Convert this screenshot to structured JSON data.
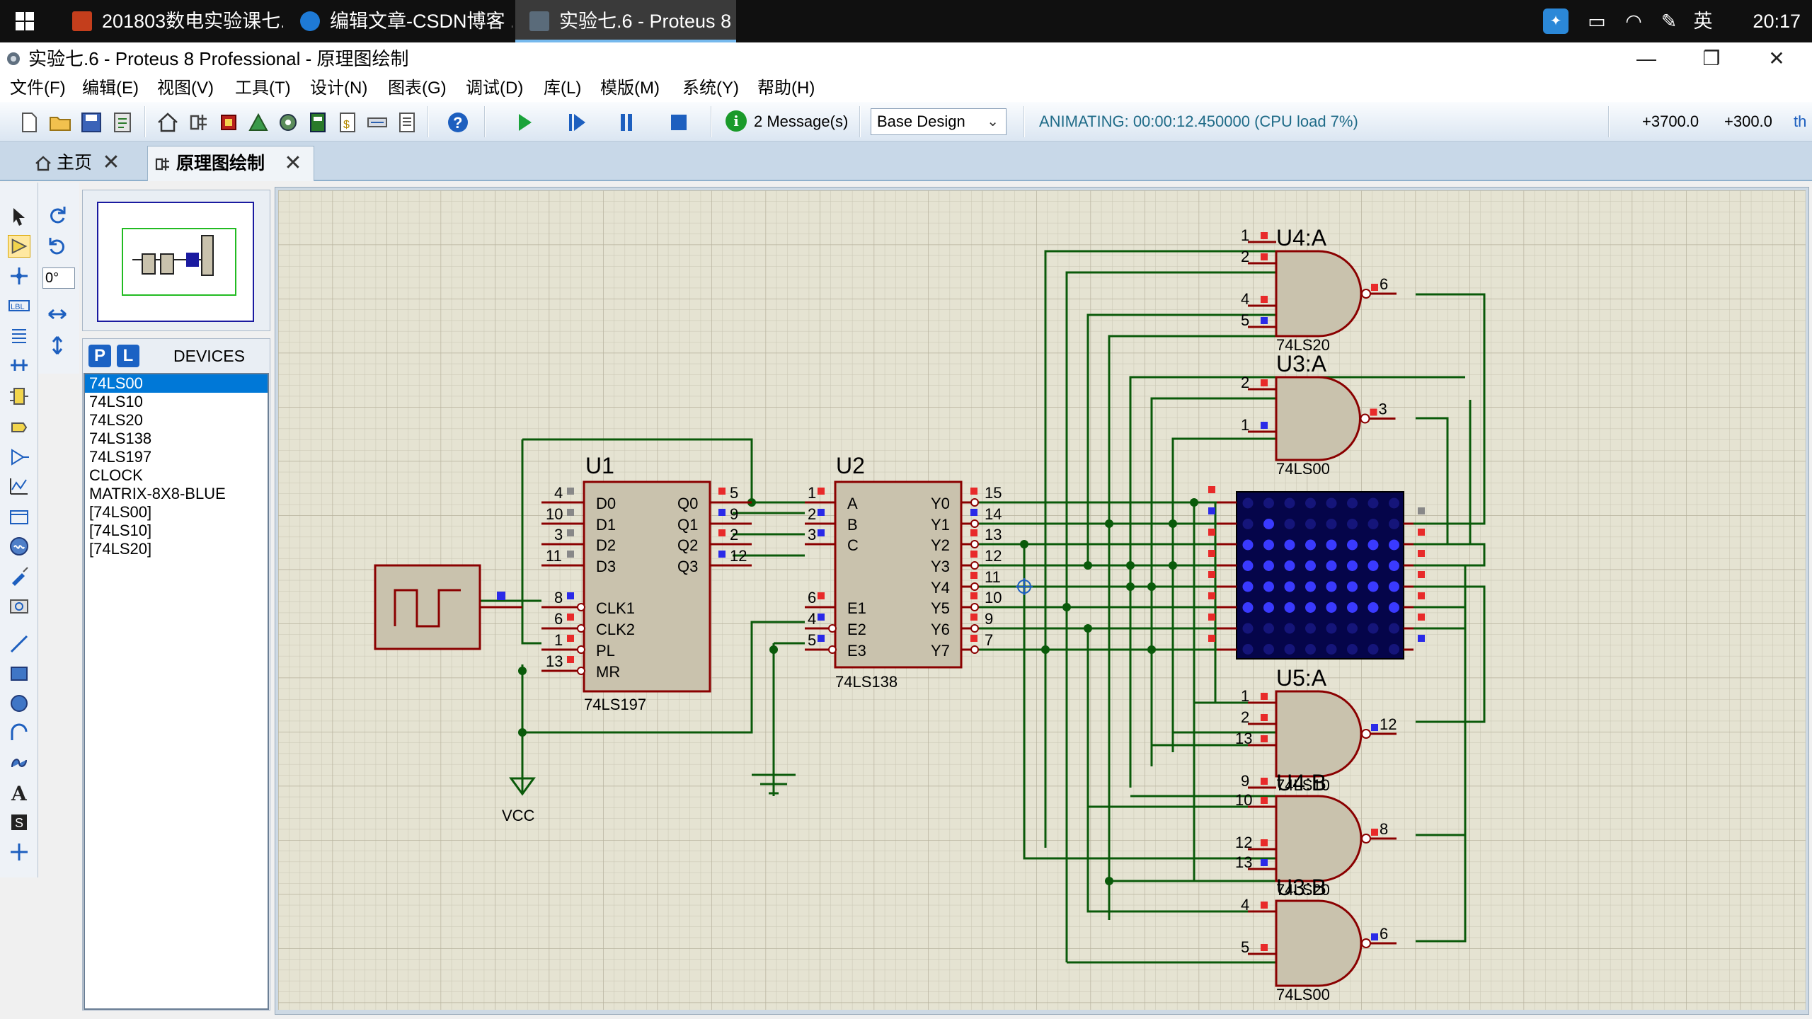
{
  "taskbar": {
    "tasks": [
      {
        "label": "201803数电实验课七..."
      },
      {
        "label": "编辑文章-CSDN博客 ..."
      },
      {
        "label": "实验七.6 - Proteus 8 ..."
      }
    ],
    "ime": "英",
    "clock": "20:17"
  },
  "window": {
    "title": "实验七.6 - Proteus 8 Professional - 原理图绘制",
    "minimize": "—",
    "maximize": "❐",
    "close": "✕"
  },
  "menu": [
    "文件(F)",
    "编辑(E)",
    "视图(V)",
    "工具(T)",
    "设计(N)",
    "图表(G)",
    "调试(D)",
    "库(L)",
    "模版(M)",
    "系统(Y)",
    "帮助(H)"
  ],
  "toolbar": {
    "messages": "2 Message(s)",
    "variant": "Base Design",
    "animating": "ANIMATING: 00:00:12.450000 (CPU load 7%)",
    "coord_x": "+3700.0",
    "coord_y": "+300.0",
    "units": "th"
  },
  "tabs": [
    {
      "label": "主页"
    },
    {
      "label": "原理图绘制"
    }
  ],
  "tools": {
    "rotation": "0°"
  },
  "devices_panel": {
    "p_button": "P",
    "l_button": "L",
    "title": "DEVICES",
    "items": [
      "74LS00",
      "74LS10",
      "74LS20",
      "74LS138",
      "74LS197",
      "CLOCK",
      "MATRIX-8X8-BLUE",
      "[74LS00]",
      "[74LS10]",
      "[74LS20]"
    ],
    "selected_index": 0
  },
  "schematic": {
    "u1": {
      "ref": "U1",
      "part": "74LS197",
      "left_pins": [
        {
          "name": "D0",
          "num": "4"
        },
        {
          "name": "D1",
          "num": "10"
        },
        {
          "name": "D2",
          "num": "3"
        },
        {
          "name": "D3",
          "num": "11"
        },
        {
          "name": "CLK1",
          "num": "8"
        },
        {
          "name": "CLK2",
          "num": "6"
        },
        {
          "name": "PL",
          "num": "1"
        },
        {
          "name": "MR",
          "num": "13"
        }
      ],
      "right_pins": [
        {
          "name": "Q0",
          "num": "5"
        },
        {
          "name": "Q1",
          "num": "9"
        },
        {
          "name": "Q2",
          "num": "2"
        },
        {
          "name": "Q3",
          "num": "12"
        }
      ]
    },
    "u2": {
      "ref": "U2",
      "part": "74LS138",
      "left_pins": [
        {
          "name": "A",
          "num": "1"
        },
        {
          "name": "B",
          "num": "2"
        },
        {
          "name": "C",
          "num": "3"
        },
        {
          "name": "E1",
          "num": "6"
        },
        {
          "name": "E2",
          "num": "4"
        },
        {
          "name": "E3",
          "num": "5"
        }
      ],
      "right_pins": [
        {
          "name": "Y0",
          "num": "15"
        },
        {
          "name": "Y1",
          "num": "14"
        },
        {
          "name": "Y2",
          "num": "13"
        },
        {
          "name": "Y3",
          "num": "12"
        },
        {
          "name": "Y4",
          "num": "11"
        },
        {
          "name": "Y5",
          "num": "10"
        },
        {
          "name": "Y6",
          "num": "9"
        },
        {
          "name": "Y7",
          "num": "7"
        }
      ]
    },
    "vcc_label": "VCC",
    "gates": [
      {
        "ref": "U4:A",
        "part": "74LS20",
        "inputs": [
          "1",
          "2",
          "4",
          "5"
        ],
        "output": "6"
      },
      {
        "ref": "U3:A",
        "part": "74LS00",
        "inputs": [
          "2",
          "1"
        ],
        "output": "3"
      },
      {
        "ref": "U5:A",
        "part": "74LS10",
        "inputs": [
          "1",
          "2",
          "13"
        ],
        "output": "12"
      },
      {
        "ref": "U4:B",
        "part": "74LS20",
        "inputs": [
          "9",
          "10",
          "12",
          "13"
        ],
        "output": "8"
      },
      {
        "ref": "U3:B",
        "part": "74LS00",
        "inputs": [
          "4",
          "5"
        ],
        "output": "6"
      }
    ]
  }
}
